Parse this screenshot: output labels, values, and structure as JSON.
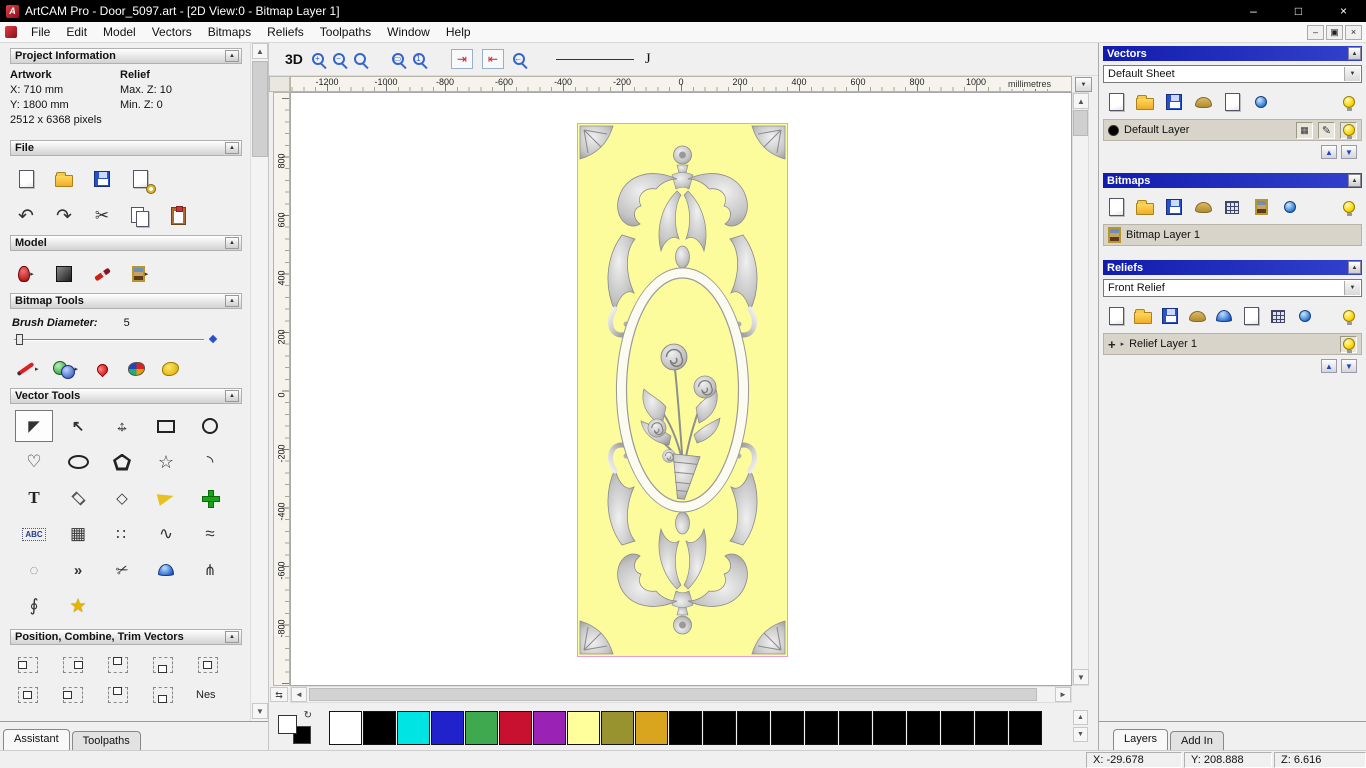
{
  "titlebar": {
    "title": "ArtCAM Pro - Door_5097.art - [2D View:0 - Bitmap Layer 1]"
  },
  "menubar": {
    "items": [
      "File",
      "Edit",
      "Model",
      "Vectors",
      "Bitmaps",
      "Reliefs",
      "Toolpaths",
      "Window",
      "Help"
    ]
  },
  "project_info": {
    "header": "Project Information",
    "artwork_label": "Artwork",
    "relief_label": "Relief",
    "x": "X: 710 mm",
    "y": "Y: 1800 mm",
    "max_z": "Max. Z: 10",
    "min_z": "Min. Z: 0",
    "pixels": "2512 x 6368 pixels"
  },
  "sections": {
    "file": "File",
    "model": "Model",
    "bitmap_tools": "Bitmap Tools",
    "vector_tools": "Vector Tools",
    "position": "Position, Combine, Trim Vectors"
  },
  "bitmap_tools": {
    "brush_label": "Brush Diameter:",
    "brush_value": "5"
  },
  "left_tabs": {
    "assistant": "Assistant",
    "toolpaths": "Toolpaths"
  },
  "toolbar": {
    "btn_3d": "3D",
    "j_handle": "J"
  },
  "rulers": {
    "units": "millimetres",
    "h_ticks": [
      "-1200",
      "-1000",
      "-800",
      "-600",
      "-400",
      "-200",
      "0",
      "200",
      "400",
      "600",
      "800",
      "1000"
    ],
    "v_ticks": [
      "800",
      "600",
      "400",
      "200",
      "0",
      "-200",
      "-400",
      "-600",
      "-800"
    ]
  },
  "right_panel": {
    "vectors": {
      "header": "Vectors",
      "sheet": "Default Sheet",
      "layer": "Default Layer"
    },
    "bitmaps": {
      "header": "Bitmaps",
      "layer": "Bitmap Layer 1"
    },
    "reliefs": {
      "header": "Reliefs",
      "relief": "Front Relief",
      "layer": "Relief Layer 1"
    },
    "tabs": {
      "layers": "Layers",
      "addin": "Add In"
    }
  },
  "palette": {
    "colors": [
      "#ffffff",
      "#000000",
      "#00e4e4",
      "#2222cc",
      "#3fa94f",
      "#c81030",
      "#9a22b4",
      "#ffff9c",
      "#98932e",
      "#d9a51f",
      "#000000",
      "#000000",
      "#000000",
      "#000000",
      "#000000",
      "#000000",
      "#000000",
      "#000000",
      "#000000",
      "#000000",
      "#000000"
    ]
  },
  "statusbar": {
    "x": "X: -29.678",
    "y": "Y: 208.888",
    "z": "Z: 6.616"
  },
  "misc": {
    "nes": "Nes",
    "abc": "ABC",
    "t": "T",
    "plus_mark": "+"
  },
  "colors": {
    "header_blue": "#1a24b4",
    "panel_bg": "#f0f0f0",
    "door_fill": "#fcfc9c",
    "door_border": "#e8a0c8"
  },
  "icons": {
    "collapse": "▲",
    "dropdown": "▼",
    "flyout": "▸",
    "up": "▲",
    "down": "▼",
    "left": "◄",
    "right": "►",
    "minimize": "–",
    "maximize": "□",
    "restore": "▣",
    "close": "×",
    "undo": "↶",
    "redo": "↷",
    "cut": "✂",
    "pencil": "✎",
    "select": "◤",
    "node_edit": "↖",
    "heart": "♡",
    "star": "☆",
    "star_gold": "★",
    "diamond": "◇",
    "arc": "◝",
    "grid": "▦",
    "dots": "∷",
    "wave": "∿",
    "approx": "≈",
    "dotted_circle": "◌",
    "chevrons": "»",
    "branch": "⋔",
    "integral": "∮",
    "hmove": "↔",
    "vmove": "↕",
    "tab_r": "⇥",
    "tab_l": "⇤",
    "swap": "⇆",
    "plus": "+",
    "minus": "−",
    "one": "1",
    "rect": "▭",
    "arrow_left": "←",
    "refresh": "↻"
  }
}
